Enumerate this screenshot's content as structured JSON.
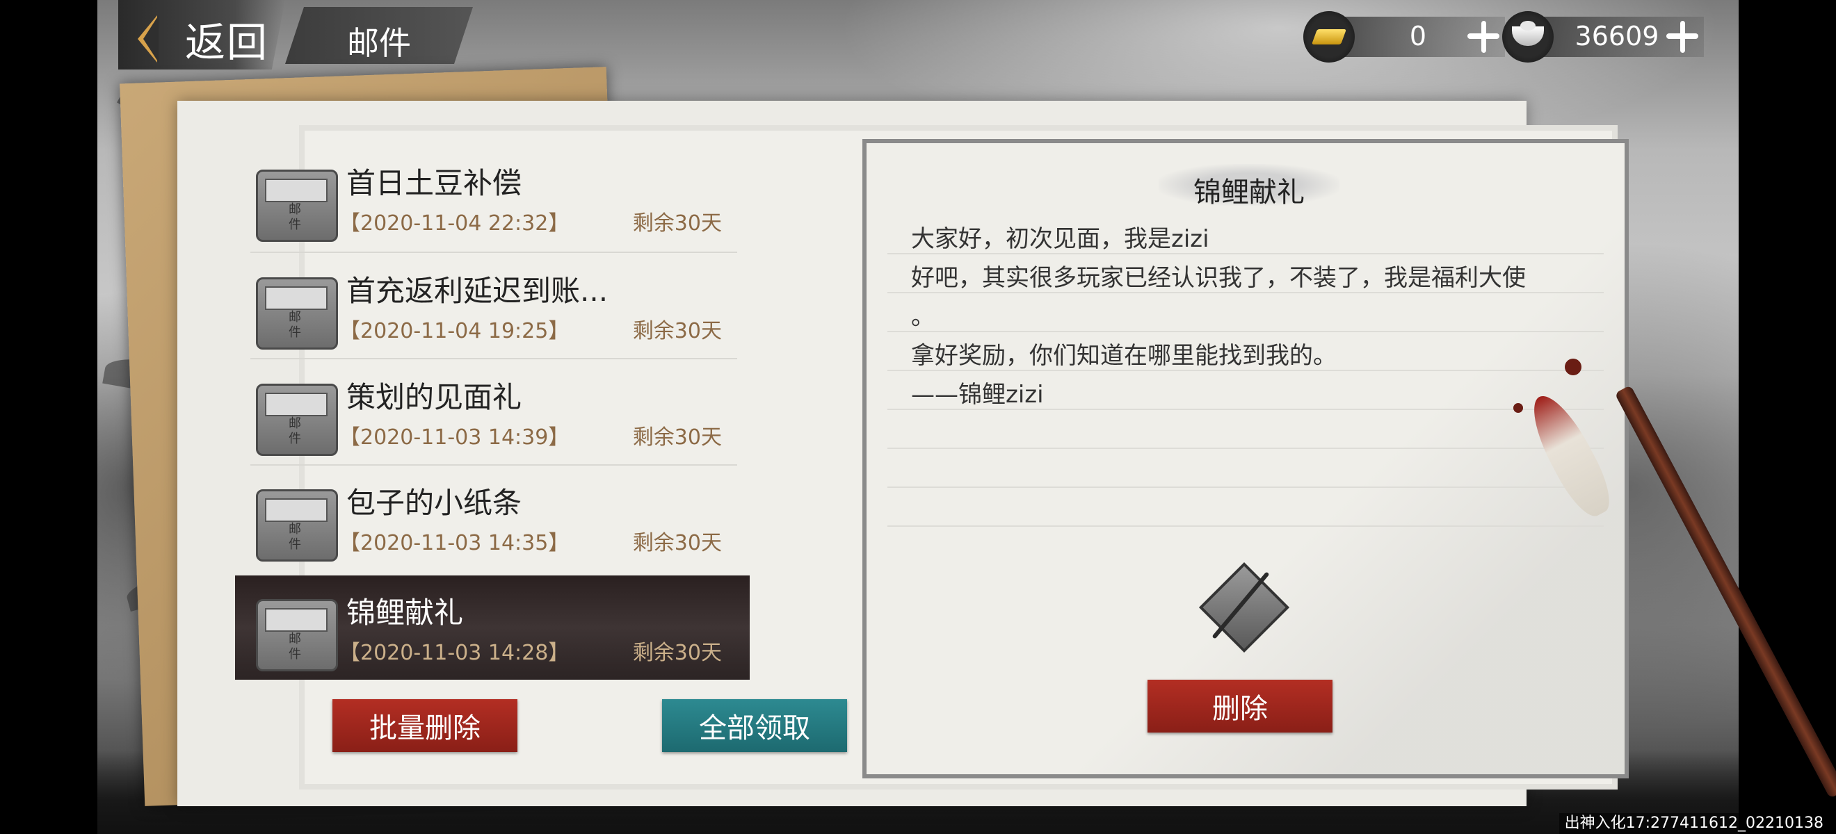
{
  "header": {
    "back_label": "返回",
    "page_title": "邮件"
  },
  "currency": {
    "gold": {
      "icon": "gold-ingot-icon",
      "value": "0"
    },
    "silver": {
      "icon": "silver-ingot-icon",
      "value": "36609"
    }
  },
  "mail_icon_text": "邮件",
  "mails": [
    {
      "title": "首日土豆补偿",
      "date": "【2020-11-04 22:32】",
      "remaining": "剩余30天",
      "selected": false
    },
    {
      "title": "首充返利延迟到账...",
      "date": "【2020-11-04 19:25】",
      "remaining": "剩余30天",
      "selected": false
    },
    {
      "title": "策划的见面礼",
      "date": "【2020-11-03 14:39】",
      "remaining": "剩余30天",
      "selected": false
    },
    {
      "title": "包子的小纸条",
      "date": "【2020-11-03 14:35】",
      "remaining": "剩余30天",
      "selected": false
    },
    {
      "title": "锦鲤献礼",
      "date": "【2020-11-03 14:28】",
      "remaining": "剩余30天",
      "selected": true
    }
  ],
  "buttons": {
    "batch_delete": "批量删除",
    "claim_all": "全部领取",
    "delete": "删除"
  },
  "detail": {
    "title": "锦鲤献礼",
    "lines": [
      "大家好，初次见面，我是zizi",
      "好吧，其实很多玩家已经认识我了，不装了，我是福利大使",
      "。",
      "拿好奖励，你们知道在哪里能找到我的。",
      "——锦鲤zizi"
    ],
    "attachment_icon": "sword-item-icon"
  },
  "footer": {
    "server_info": "出神入化17:277411612_02210138"
  },
  "colors": {
    "accent_red": "#b32e23",
    "accent_teal": "#2d8a91",
    "date_brown": "#8c6a46"
  }
}
